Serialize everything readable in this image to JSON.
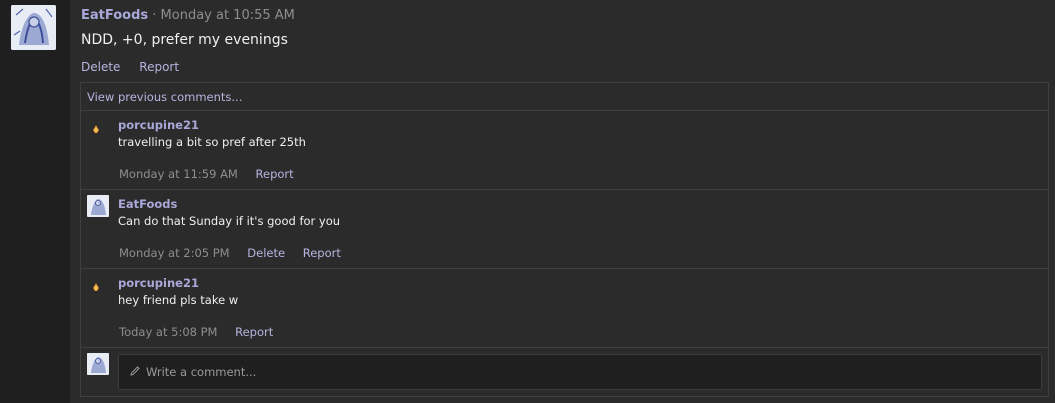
{
  "post": {
    "author": "EatFoods",
    "meta": " · Monday at 10:55 AM",
    "body": "NDD, +0, prefer my evenings",
    "actions": {
      "delete": "Delete",
      "report": "Report"
    }
  },
  "comments": {
    "view_previous": "View previous comments...",
    "items": [
      {
        "author": "porcupine21",
        "text": "travelling a bit so pref after 25th",
        "time": "Monday at 11:59 AM",
        "report": "Report"
      },
      {
        "author": "EatFoods",
        "text": "Can do that Sunday if it's good for you",
        "time": "Monday at 2:05 PM",
        "delete": "Delete",
        "report": "Report"
      },
      {
        "author": "porcupine21",
        "text": "hey friend pls take w",
        "time": "Today at 5:08 PM",
        "report": "Report"
      }
    ],
    "composer": {
      "placeholder": "Write a comment..."
    }
  }
}
